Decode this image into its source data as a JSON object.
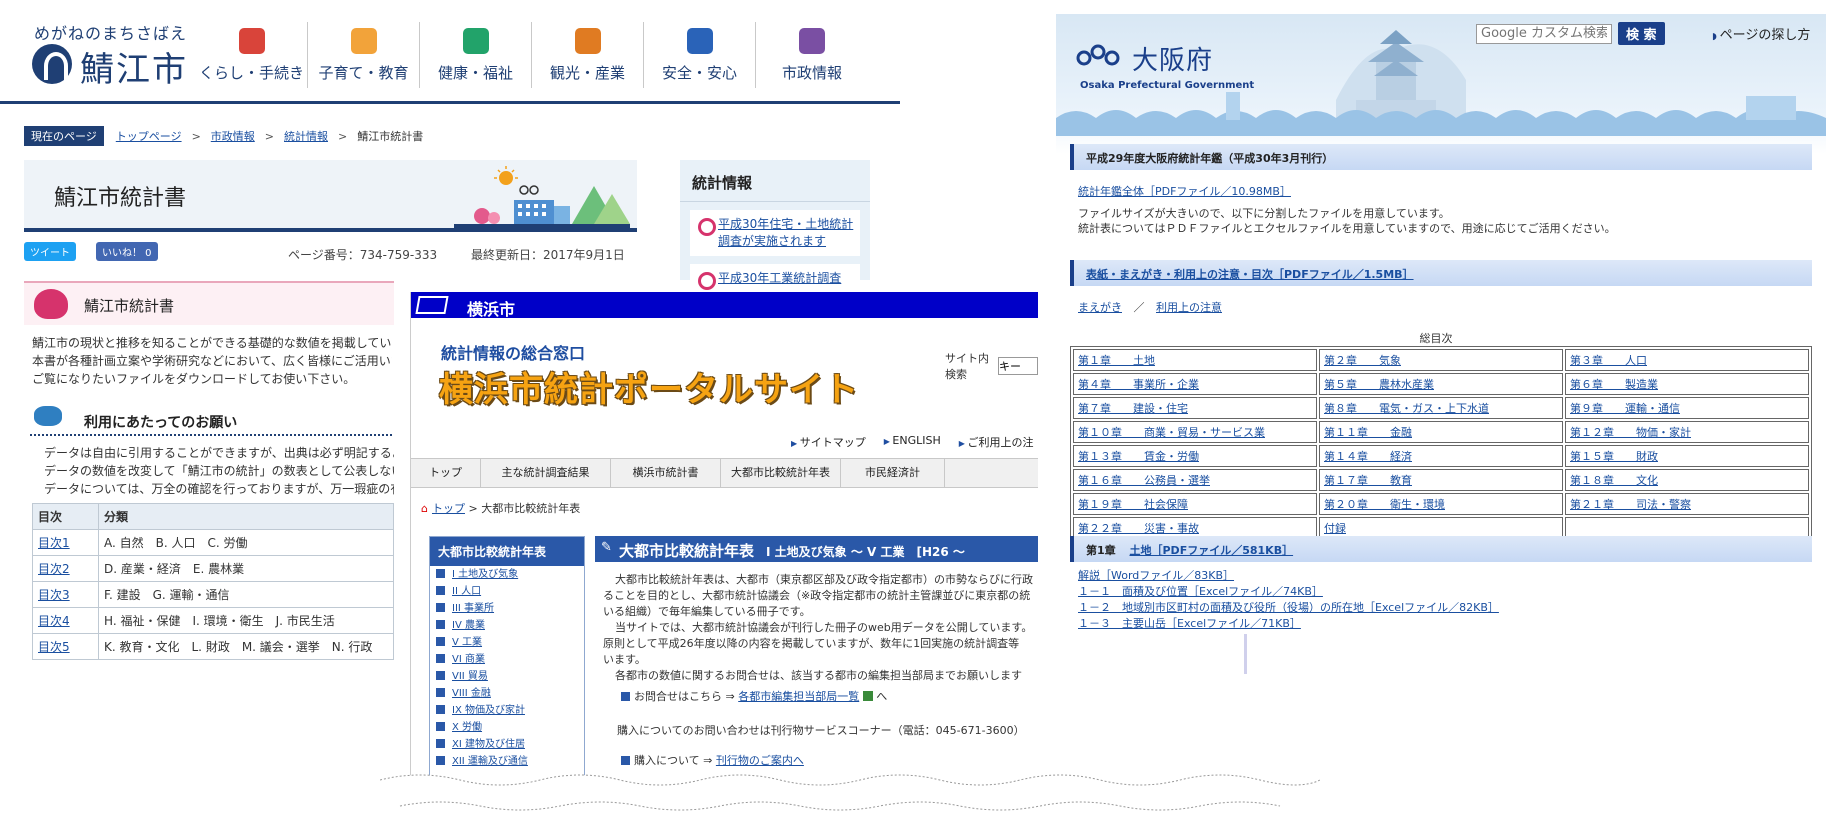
{
  "sabae": {
    "logo_tagline": "めがねのまちさばえ",
    "logo_name": "鯖江市",
    "nav": [
      {
        "label": "くらし・手続き",
        "icon": "house-icon",
        "color": "#d9443a"
      },
      {
        "label": "子育て・教育",
        "icon": "child-icon",
        "color": "#f2a33a"
      },
      {
        "label": "健康・福祉",
        "icon": "heart-icon",
        "color": "#22a36a"
      },
      {
        "label": "観光・産業",
        "icon": "binoculars-icon",
        "color": "#e07b22"
      },
      {
        "label": "安全・安心",
        "icon": "lock-icon",
        "color": "#2a63b8"
      },
      {
        "label": "市政情報",
        "icon": "buildings-icon",
        "color": "#7a4fa3"
      }
    ],
    "breadcrumb": {
      "here_label": "現在のページ",
      "items": [
        "トップページ",
        "市政情報",
        "統計情報"
      ],
      "current": "鯖江市統計書",
      "sep": ">"
    },
    "page_title": "鯖江市統計書",
    "share": {
      "tweet": "ツイート",
      "like": "いいね！ 0"
    },
    "meta": {
      "page_number": "ページ番号：734-759-333",
      "updated": "最終更新日：2017年9月1日"
    },
    "sidebar": {
      "heading": "統計情報",
      "items": [
        "平成30年住宅・土地統計調査が実施されます",
        "平成30年工業統計調査"
      ]
    },
    "section1_title": "鯖江市統計書",
    "intro_lines": [
      "鯖江市の現状と推移を知ることができる基礎的な数値を掲載していま",
      "本書が各種計画立案や学術研究などにおいて、広く皆様にご活用いた",
      "ご覧になりたいファイルをダウンロードしてお使い下さい。"
    ],
    "section2_title": "利用にあたってのお願い",
    "notice_lines": [
      "データは自由に引用することができますが、出典は必ず明記するよ",
      "データの数値を改変して「鯖江市の統計」の数表として公表しない",
      "データについては、万全の確認を行っておりますが、万一瑕疵の有"
    ],
    "table": {
      "headers": [
        "目次",
        "分類"
      ],
      "rows": [
        [
          "目次1",
          "A. 自然　B. 人口　C. 労働"
        ],
        [
          "目次2",
          "D. 産業・経済　E. 農林業"
        ],
        [
          "目次3",
          "F. 建設　G. 運輸・通信"
        ],
        [
          "目次4",
          "H. 福祉・保健　I. 環境・衛生　J. 市民生活"
        ],
        [
          "目次5",
          "K. 教育・文化　L. 財政　M. 議会・選挙　N. 行政"
        ]
      ]
    }
  },
  "yokohama": {
    "bar_title": "横浜市",
    "subtitle": "統計情報の総合窓口",
    "big_title": "横浜市統計ポータルサイト",
    "search_label": "サイト内検索",
    "search_value": "キー",
    "util_links": [
      "サイトマップ",
      "ENGLISH",
      "ご利用上の注"
    ],
    "gnav": [
      "トップ",
      "主な統計調査結果",
      "横浜市統計書",
      "大都市比較統計年表",
      "市民経済計"
    ],
    "breadcrumb": [
      "トップ",
      "大都市比較統計年表"
    ],
    "left_nav": {
      "heading": "大都市比較統計年表",
      "items": [
        "I 土地及び気象",
        "II 人口",
        "III 事業所",
        "IV 農業",
        "V 工業",
        "VI 商業",
        "VII 貿易",
        "VIII 金融",
        "IX 物価及び家計",
        "X 労働",
        "XI 建物及び住居",
        "XII 運輸及び通信"
      ]
    },
    "main_heading": "大都市比較統計年表",
    "main_heading_sub": "I 土地及び気象 ～ V 工業　[H26 ～",
    "body_lines": [
      "大都市比較統計年表は、大都市（東京都区部及び政令指定都市）の市勢ならびに行政",
      "ることを目的とし、大都市統計協議会（※政令指定都市の統計主管課並びに東京都の統",
      "いる組織）で毎年編集している冊子です。",
      "当サイトでは、大都市統計協議会が刊行した冊子のweb用データを公開しています。",
      "原則として平成26年度以降の内容を掲載していますが、数年に1回実施の統計調査等",
      "います。",
      "各都市の数値に関するお問合せは、該当する都市の編集担当部局までお願いします"
    ],
    "contact_label": "お問合せはこちら",
    "contact_arrow": "⇒",
    "contact_link": "各都市編集担当部局一覧",
    "contact_suffix": "へ",
    "buy_text": "購入についてのお問い合わせは刊行物サービスコーナー（電話：045-671-3600）",
    "buy2_label": "購入について",
    "buy2_link": "刊行物のご案内へ"
  },
  "osaka": {
    "name": "大阪府",
    "name_en": "Osaka Prefectural Government",
    "search_placeholder": "Google カスタム検索",
    "search_button": "検 索",
    "find_page": "ページの探し方",
    "h1": "平成29年度大阪府統計年鑑（平成30年3月刊行）",
    "full_pdf": "統計年鑑全体［PDFファイル／10.98MB］",
    "info_lines": [
      "ファイルサイズが大きいので、以下に分割したファイルを用意しています。",
      "統計表についてはＰＤＦファイルとエクセルファイルを用意していますので、用途に応じてご活用ください。"
    ],
    "h2_link": "表紙・まえがき・利用上の注意・目次［PDFファイル／1.5MB］",
    "sub_links": [
      "まえがき",
      "利用上の注意"
    ],
    "sub_sep": "／",
    "toc_label": "総目次",
    "chapters": [
      [
        "第１章　　土地",
        "第２章　　気象",
        "第３章　　人口"
      ],
      [
        "第４章　　事業所・企業",
        "第５章　　農林水産業",
        "第６章　　製造業"
      ],
      [
        "第７章　　建設・住宅",
        "第８章　　電気・ガス・上下水道",
        "第９章　　運輸・通信"
      ],
      [
        "第１０章　　商業・貿易・サービス業",
        "第１１章　　金融",
        "第１２章　　物価・家計"
      ],
      [
        "第１３章　　賃金・労働",
        "第１４章　　経済",
        "第１５章　　財政"
      ],
      [
        "第１６章　　公務員・選挙",
        "第１７章　　教育",
        "第１８章　　文化"
      ],
      [
        "第１９章　　社会保障",
        "第２０章　　衛生・環境",
        "第２１章　　司法・警察"
      ],
      [
        "第２２章　　災害・事故",
        "付録",
        ""
      ]
    ],
    "ch1_label": "第1章",
    "ch1_link": "土地［PDFファイル／581KB］",
    "files": [
      "解説［Wordファイル／83KB］",
      "１－１　面積及び位置［Excelファイル／74KB］",
      "１－２　地域別市区町村の面積及び役所（役場）の所在地［Excelファイル／82KB］",
      "１－３　主要山岳［Excelファイル／71KB］"
    ]
  }
}
